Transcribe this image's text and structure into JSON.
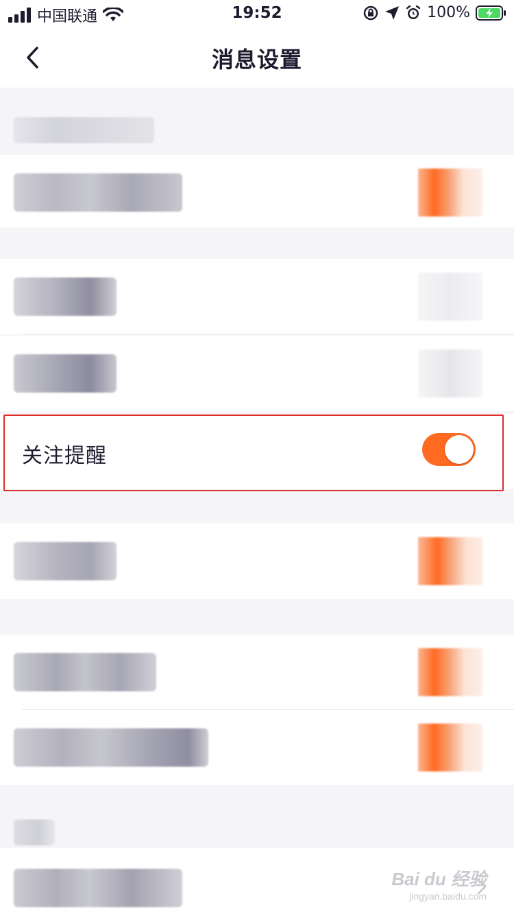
{
  "status_bar": {
    "carrier": "中国联通",
    "time": "19:52",
    "battery_text": "100%",
    "icons": [
      "signal-icon",
      "wifi-icon",
      "rotation-lock-icon",
      "location-icon",
      "alarm-icon",
      "battery-charging-icon"
    ]
  },
  "nav": {
    "back_icon": "chevron-left-icon",
    "title": "消息设置"
  },
  "settings": {
    "focus_reminder": {
      "label": "关注提醒",
      "enabled": true
    }
  },
  "colors": {
    "accent": "#ff6a21",
    "highlight_border": "#e02b2b",
    "background": "#f5f5f7",
    "row_background": "#ffffff",
    "text": "#1c1c2e"
  },
  "watermark": {
    "main": "Bai du 经验",
    "sub": "jingyan.baidu.com"
  }
}
